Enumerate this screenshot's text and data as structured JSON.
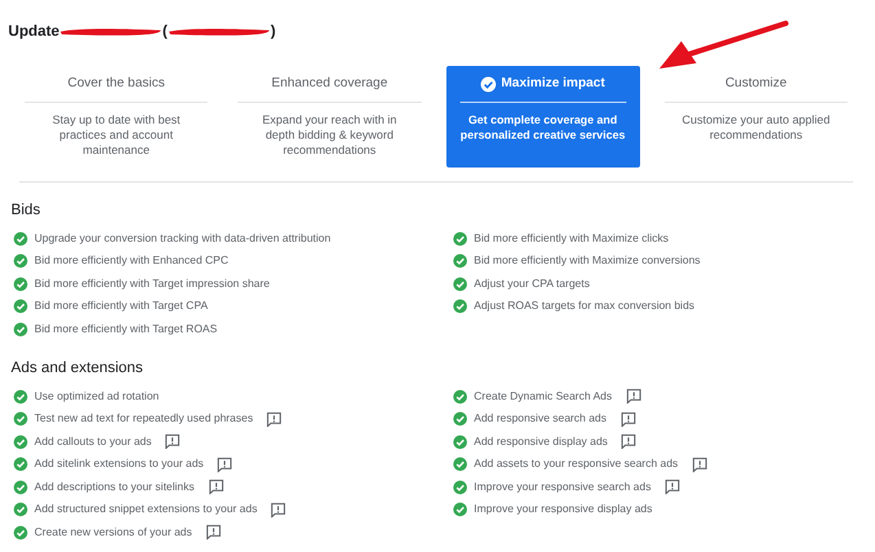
{
  "title_fragments": [
    "Update",
    "(",
    ")"
  ],
  "annotation": {
    "kind": "arrow"
  },
  "options": [
    {
      "title": "Cover the basics",
      "description": "Stay up to date with best practices and account maintenance",
      "selected": false
    },
    {
      "title": "Enhanced coverage",
      "description": "Expand your reach with in depth bidding & keyword recommendations",
      "selected": false
    },
    {
      "title": "Maximize impact",
      "description": "Get complete coverage and personalized creative services",
      "selected": true
    },
    {
      "title": "Customize",
      "description": "Customize your auto applied recommendations",
      "selected": false
    }
  ],
  "sections": [
    {
      "heading": "Bids",
      "columns": [
        [
          {
            "label": "Upgrade your conversion tracking with data-driven attribution",
            "feedback": false
          },
          {
            "label": "Bid more efficiently with Enhanced CPC",
            "feedback": false
          },
          {
            "label": "Bid more efficiently with Target impression share",
            "feedback": false
          },
          {
            "label": "Bid more efficiently with Target CPA",
            "feedback": false
          },
          {
            "label": "Bid more efficiently with Target ROAS",
            "feedback": false
          }
        ],
        [
          {
            "label": "Bid more efficiently with Maximize clicks",
            "feedback": false
          },
          {
            "label": "Bid more efficiently with Maximize conversions",
            "feedback": false
          },
          {
            "label": "Adjust your CPA targets",
            "feedback": false
          },
          {
            "label": "Adjust ROAS targets for max conversion bids",
            "feedback": false
          }
        ]
      ]
    },
    {
      "heading": "Ads and extensions",
      "columns": [
        [
          {
            "label": "Use optimized ad rotation",
            "feedback": false
          },
          {
            "label": "Test new ad text for repeatedly used phrases",
            "feedback": true
          },
          {
            "label": "Add callouts to your ads",
            "feedback": true
          },
          {
            "label": "Add sitelink extensions to your ads",
            "feedback": true
          },
          {
            "label": "Add descriptions to your sitelinks",
            "feedback": true
          },
          {
            "label": "Add structured snippet extensions to your ads",
            "feedback": true
          },
          {
            "label": "Create new versions of your ads",
            "feedback": true
          }
        ],
        [
          {
            "label": "Create Dynamic Search Ads",
            "feedback": true
          },
          {
            "label": "Add responsive search ads",
            "feedback": true
          },
          {
            "label": "Add responsive display ads",
            "feedback": true
          },
          {
            "label": "Add assets to your responsive search ads",
            "feedback": true
          },
          {
            "label": "Improve your responsive search ads",
            "feedback": true
          },
          {
            "label": "Improve your responsive display ads",
            "feedback": false
          }
        ]
      ]
    }
  ]
}
